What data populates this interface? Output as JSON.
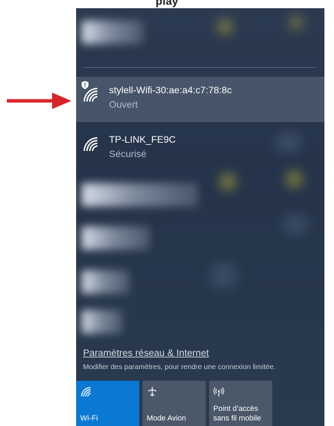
{
  "header": {
    "text": "play"
  },
  "networks": [
    {
      "ssid": "stylell-Wifi-30:ae:a4:c7:78:8c",
      "status": "Ouvert",
      "secured": false,
      "selected": true
    },
    {
      "ssid": "TP-LINK_FE9C",
      "status": "Sécurisé",
      "secured": true,
      "selected": false
    }
  ],
  "settings": {
    "link": "Paramètres réseau & Internet",
    "description": "Modifier des paramètres, pour rendre une connexion limitée."
  },
  "tiles": [
    {
      "label": "Wi-Fi",
      "icon": "wifi-icon",
      "active": true
    },
    {
      "label": "Mode Avion",
      "icon": "airplane-icon",
      "active": false
    },
    {
      "label": "Point d'accès\nsans fil mobile",
      "label_line1": "Point d’accès",
      "label_line2": "sans fil mobile",
      "icon": "hotspot-icon",
      "active": false
    }
  ],
  "colors": {
    "panel_bg": "#2b3a50",
    "selected_row": "#465569",
    "active_tile": "#0b78d4",
    "tile": "#4a5869",
    "annotation_arrow": "#d8232a"
  }
}
